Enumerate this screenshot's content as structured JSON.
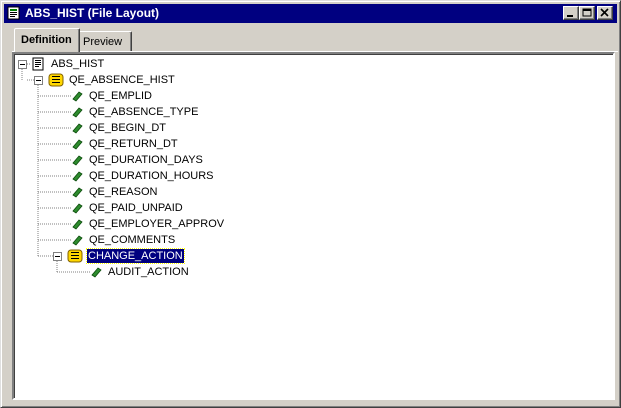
{
  "window": {
    "title": "ABS_HIST (File Layout)"
  },
  "tabs": [
    {
      "label": "Definition",
      "active": true
    },
    {
      "label": "Preview",
      "active": false
    }
  ],
  "tree": {
    "root": {
      "label": "ABS_HIST",
      "icon": "file-layout-icon"
    },
    "records": [
      {
        "label": "QE_ABSENCE_HIST",
        "icon": "record-icon",
        "fields": [
          "QE_EMPLID",
          "QE_ABSENCE_TYPE",
          "QE_BEGIN_DT",
          "QE_RETURN_DT",
          "QE_DURATION_DAYS",
          "QE_DURATION_HOURS",
          "QE_REASON",
          "QE_PAID_UNPAID",
          "QE_EMPLOYER_APPROV",
          "QE_COMMENTS"
        ]
      },
      {
        "label": "CHANGE_ACTION",
        "icon": "record-icon",
        "selected": true,
        "fields": [
          "AUDIT_ACTION"
        ]
      }
    ]
  },
  "colors": {
    "titlebar": "#000080",
    "selection": "#000080",
    "field_icon": "#2e8b2e",
    "record_icon": "#ffd700"
  }
}
